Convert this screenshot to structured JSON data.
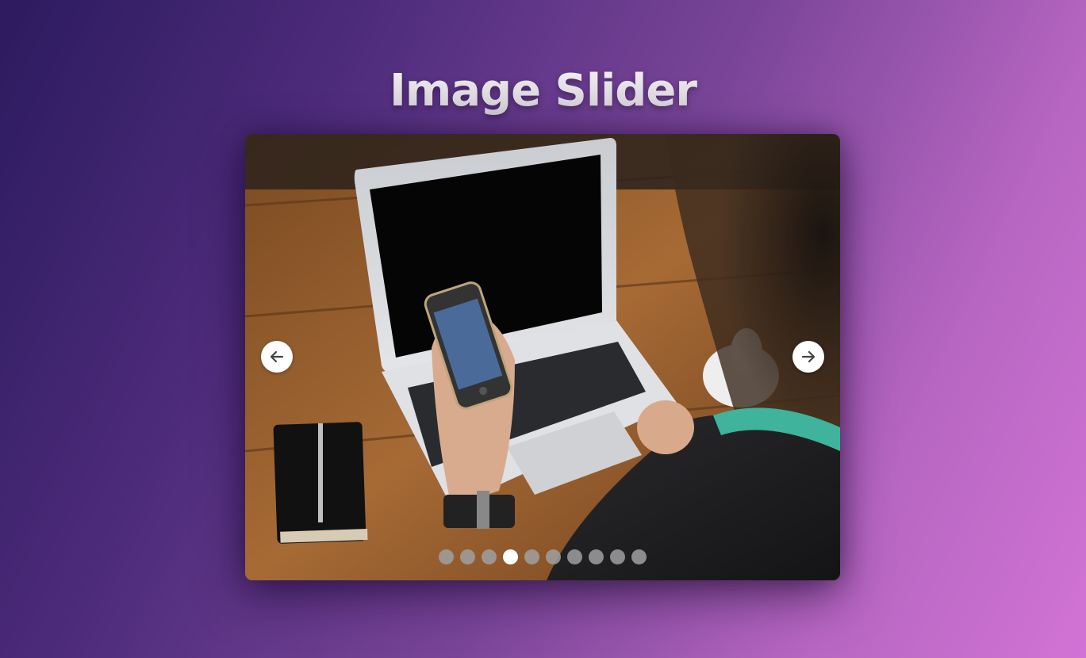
{
  "page": {
    "title": "Image Slider"
  },
  "slider": {
    "prev_icon": "arrow-left-icon",
    "next_icon": "arrow-right-icon",
    "dot_count": 10,
    "active_index": 3,
    "slide_image": "photo-person-holding-phone-at-laptop-desk"
  },
  "colors": {
    "bg_start": "#2c1b5e",
    "bg_end": "#d173d6",
    "dot_inactive": "#a0a0a0",
    "dot_active": "#ffffff"
  }
}
